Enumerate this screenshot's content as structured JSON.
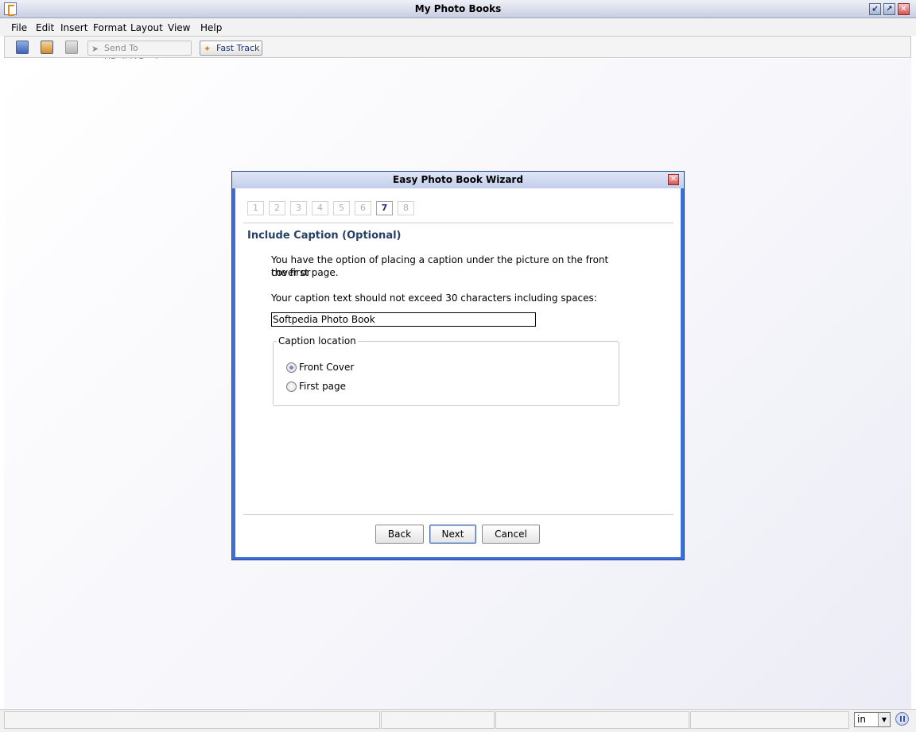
{
  "window": {
    "title": "My Photo Books"
  },
  "menu": [
    "File",
    "Edit",
    "Insert",
    "Format",
    "Layout",
    "View",
    "Help"
  ],
  "toolbar": {
    "send_label": "Send To  UBuildABook",
    "fast_track_label": "Fast Track",
    "icons": [
      "new-book-icon",
      "edit-book-icon",
      "save-icon"
    ]
  },
  "dialog": {
    "title": "Easy Photo Book Wizard",
    "steps": [
      "1",
      "2",
      "3",
      "4",
      "5",
      "6",
      "7",
      "8"
    ],
    "current_step": "7",
    "heading": "Include Caption (Optional)",
    "intro_line1": "You have the option of placing a caption under the picture on the front cover or",
    "intro_line2": "the first page.",
    "limit_text": "Your caption text should not exceed 30 characters including spaces:",
    "caption_value": "Softpedia Photo Book",
    "location_group": {
      "label": "Caption location",
      "options": [
        "Front Cover",
        "First page"
      ],
      "selected": "Front Cover"
    },
    "buttons": {
      "back": "Back",
      "next": "Next",
      "cancel": "Cancel"
    }
  },
  "statusbar": {
    "unit": "in"
  }
}
